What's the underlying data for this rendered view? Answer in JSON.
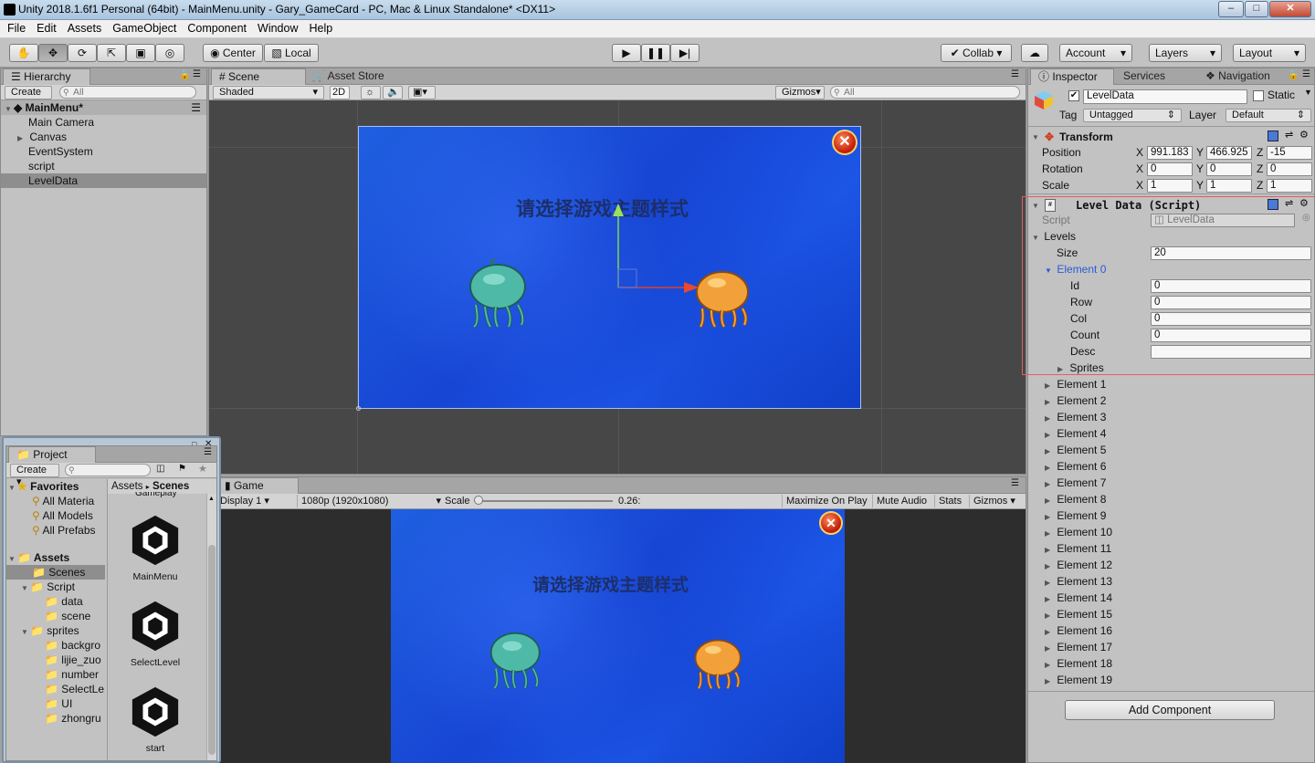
{
  "window": {
    "title": "Unity 2018.1.6f1 Personal (64bit) - MainMenu.unity - Gary_GameCard - PC, Mac & Linux Standalone* <DX11>",
    "minimize": "–",
    "maximize": "□",
    "close": "✕"
  },
  "menu": [
    "File",
    "Edit",
    "Assets",
    "GameObject",
    "Component",
    "Window",
    "Help"
  ],
  "toolbar": {
    "pivot": "Center",
    "space": "Local",
    "collab": "Collab ▾",
    "account": "Account",
    "layers": "Layers",
    "layout": "Layout"
  },
  "hierarchy": {
    "tab": "Hierarchy",
    "create": "Create ▾",
    "search_placeholder": "All",
    "scene": "MainMenu*",
    "items": [
      "Main Camera",
      "Canvas",
      "EventSystem",
      "script",
      "LevelData"
    ]
  },
  "scene": {
    "tab": "Scene",
    "tab2": "Asset Store",
    "shading": "Shaded",
    "mode2d": "2D",
    "gizmos": "Gizmos",
    "search_placeholder": "All",
    "title_text": "请选择游戏主题样式"
  },
  "game": {
    "tab": "Game",
    "display": "Display 1",
    "resolution": "1080p (1920x1080)",
    "scale_label": "Scale",
    "scale_value": "0.26:",
    "maximize": "Maximize On Play",
    "mute": "Mute Audio",
    "stats": "Stats",
    "gizmos": "Gizmos",
    "title_text": "请选择游戏主题样式"
  },
  "project": {
    "tab": "Project",
    "create": "Create ▾",
    "favorites": "Favorites",
    "fav_items": [
      "All Materia",
      "All Models",
      "All Prefabs"
    ],
    "assets": "Assets",
    "tree": [
      "Scenes",
      "Script",
      "data",
      "scene",
      "sprites",
      "backgro",
      "lijie_zuo",
      "number",
      "SelectLe",
      "UI",
      "zhongru"
    ],
    "breadcrumb_root": "Assets",
    "breadcrumb_sep": "▸",
    "breadcrumb_leaf": "Scenes",
    "top_cut": "Gameplay",
    "scene_assets": [
      "MainMenu",
      "SelectLevel",
      "start"
    ]
  },
  "inspector": {
    "tab": "Inspector",
    "tab2": "Services",
    "tab3": "Navigation",
    "object_name": "LevelData",
    "static": "Static",
    "tag_label": "Tag",
    "tag_value": "Untagged",
    "layer_label": "Layer",
    "layer_value": "Default",
    "transform": {
      "header": "Transform",
      "position_label": "Position",
      "pos": [
        "991.183",
        "466.925",
        "-15"
      ],
      "rotation_label": "Rotation",
      "rot": [
        "0",
        "0",
        "0"
      ],
      "scale_label": "Scale",
      "scl": [
        "1",
        "1",
        "1"
      ],
      "axes": [
        "X",
        "Y",
        "Z"
      ]
    },
    "level_data": {
      "header": "Level Data (Script)",
      "script_label": "Script",
      "script_value": "LevelData",
      "levels_label": "Levels",
      "size_label": "Size",
      "size_value": "20",
      "element0": "Element 0",
      "fields": [
        {
          "label": "Id",
          "value": "0"
        },
        {
          "label": "Row",
          "value": "0"
        },
        {
          "label": "Col",
          "value": "0"
        },
        {
          "label": "Count",
          "value": "0"
        },
        {
          "label": "Desc",
          "value": ""
        }
      ],
      "sprites_label": "Sprites",
      "elements": [
        "Element 1",
        "Element 2",
        "Element 3",
        "Element 4",
        "Element 5",
        "Element 6",
        "Element 7",
        "Element 8",
        "Element 9",
        "Element 10",
        "Element 11",
        "Element 12",
        "Element 13",
        "Element 14",
        "Element 15",
        "Element 16",
        "Element 17",
        "Element 18",
        "Element 19"
      ]
    },
    "add_component": "Add Component"
  },
  "colors": {
    "highlight_box": "#e06060",
    "scene_bg": "#474747",
    "selection": "#8e8e8e",
    "element_blue": "#2a5bd7"
  }
}
